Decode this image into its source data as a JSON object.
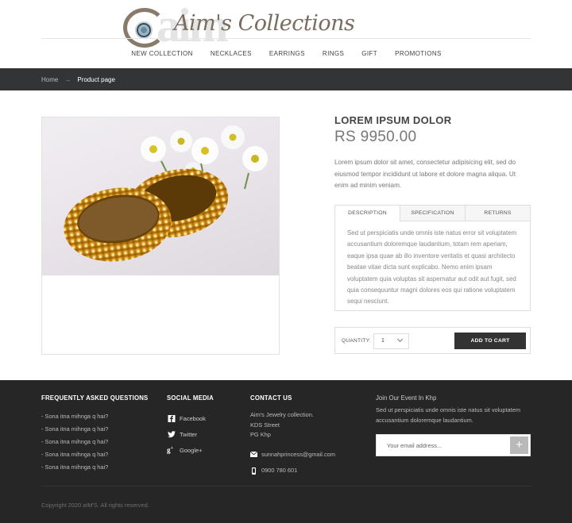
{
  "brand": {
    "logo_text": "Aim's Collections",
    "ghost_text": "aim",
    "colors": {
      "accent": "#7a6c5e",
      "dark_bar": "#333435",
      "footer_bg": "#262626",
      "button": "#333333"
    }
  },
  "nav": {
    "items": [
      "NEW COLLECTION",
      "NECKLACES",
      "EARRINGS",
      "RINGS",
      "GIFT",
      "PROMOTIONS"
    ]
  },
  "breadcrumb": {
    "home": "Home",
    "separator": "→",
    "current": "Product page"
  },
  "product": {
    "title": "LOREM IPSUM DOLOR",
    "price": "RS 9950.00",
    "description": "Lorem ipsum dolor sit amet, consectetur adipisicing elit, sed do eiusmod tempor incididunt ut labore et dolore magna aliqua. Ut enim ad minim veniam.",
    "tabs": [
      "DESCRIPTION",
      "SPECIFICATION",
      "RETURNS"
    ],
    "active_tab": "DESCRIPTION",
    "tab_content": "Sed ut perspiciatis unde omnis iste natus error sit voluptatem accusantium doloremque laudantium, totam rem aperiam, eaque ipsa quae ab illo inventore veritatis et quasi architecto beatae vitae dicta sunt explicabo. Nemo enim ipsam voluptatem quia voluptas sit aspernatur aut odit aut fugit, sed quia consequuntur magni dolores eos qui ratione voluptatem sequi nesciunt.",
    "quantity_label": "QUANTITY:",
    "quantity_value": "1",
    "add_to_cart": "ADD TO CART"
  },
  "footer": {
    "faq": {
      "heading": "FREQUENTLY ASKED QUESTIONS",
      "items": [
        "- Sona itna mihnga q hai?",
        "- Sona itna mihnga q hai?",
        "- Sona itna mihnga q hai?",
        "- Sona itna mihnga q hai?",
        "- Sona itna mihnga q hai?"
      ]
    },
    "social": {
      "heading": "SOCIAL MEDIA",
      "items": [
        {
          "label": "Facebook",
          "icon": "facebook-icon"
        },
        {
          "label": "Twitter",
          "icon": "twitter-icon"
        },
        {
          "label": "Google+",
          "icon": "google-plus-icon"
        }
      ]
    },
    "contact": {
      "heading": "CONTACT US",
      "address": [
        "Aim's Jewelry collection.",
        "KDS Street",
        "PG Khp"
      ],
      "email": "sunnahprincess@gmail.com",
      "phone": "0900 780 601"
    },
    "newsletter": {
      "title": "Join Our Event In Khp",
      "text": "Sed ut perspiciatis unde omnis iste natus sit voluptatem accusantium doloremque laudantium.",
      "placeholder": "Your email address...",
      "button": "+"
    },
    "copyright": "Copyright 2020 aIM'S. All rights reserved."
  }
}
